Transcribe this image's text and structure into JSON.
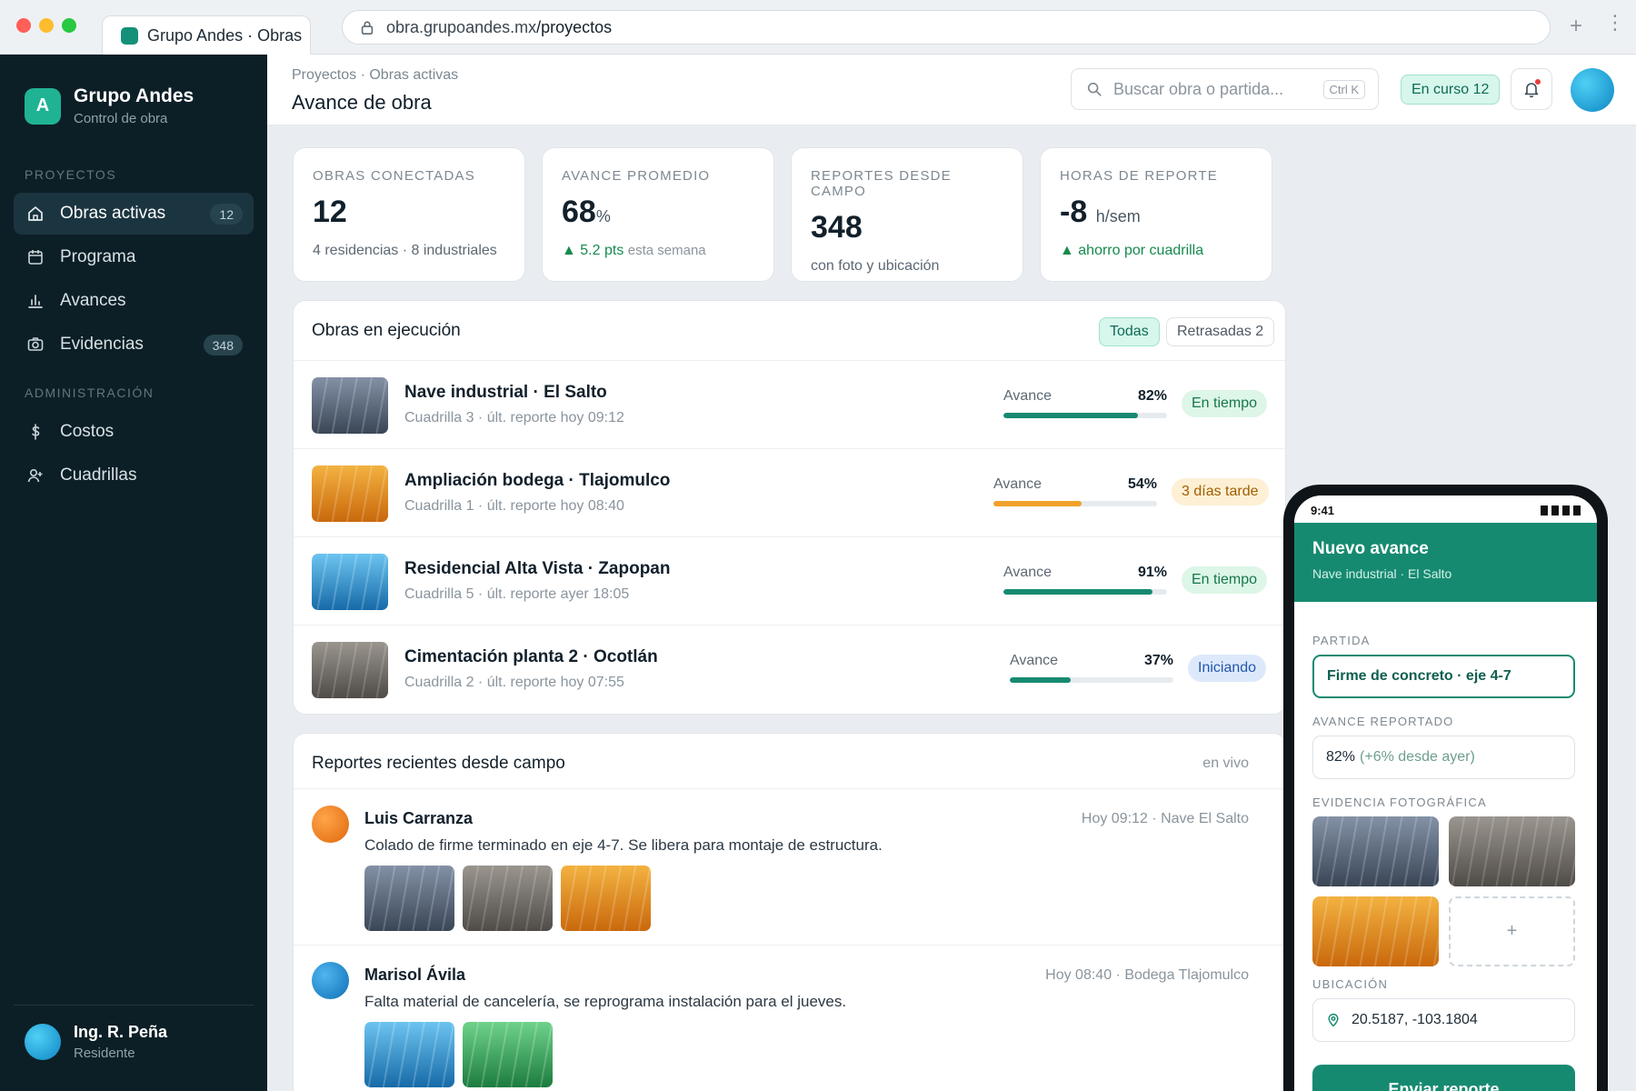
{
  "browser": {
    "tab_title": "Grupo Andes · Obras",
    "url_host": "obra.grupoandes.mx",
    "url_path": "/proyectos",
    "new_tab_label": "+",
    "menu_label": "⋮"
  },
  "sidebar": {
    "brand_letter": "A",
    "brand_name": "Grupo Andes",
    "brand_sub": "Control de obra",
    "section_projects": "PROYECTOS",
    "section_admin": "ADMINISTRACIÓN",
    "items": [
      {
        "label": "Obras activas",
        "badge": "12",
        "icon": "home-icon"
      },
      {
        "label": "Programa",
        "icon": "calendar-icon"
      },
      {
        "label": "Avances",
        "icon": "bar-chart-icon"
      },
      {
        "label": "Evidencias",
        "badge": "348",
        "icon": "camera-icon"
      },
      {
        "label": "Costos",
        "icon": "dollar-icon"
      },
      {
        "label": "Cuadrillas",
        "icon": "user-add-icon"
      }
    ],
    "user_name": "Ing. R. Peña",
    "user_role": "Residente"
  },
  "header": {
    "breadcrumb": "Proyectos · Obras activas",
    "title": "Avance de obra",
    "search_placeholder": "Buscar obra o partida...",
    "shortcut": "Ctrl K",
    "status_pill": "En curso 12"
  },
  "stats": [
    {
      "label": "OBRAS CONECTADAS",
      "value": "12",
      "unit": "",
      "note": "4 residencias · 8 industriales"
    },
    {
      "label": "AVANCE PROMEDIO",
      "value": "68",
      "unit": "%",
      "note_up": "▲ 5.2 pts",
      "note": "esta semana"
    },
    {
      "label": "REPORTES DESDE CAMPO",
      "value": "348",
      "unit": "",
      "note": "con foto y ubicación"
    },
    {
      "label": "HORAS DE REPORTE",
      "value": "-8",
      "unit": "h/sem",
      "note_up": "▲ ahorro por cuadrilla"
    }
  ],
  "projects": {
    "title": "Obras en ejecución",
    "filter_all": "Todas",
    "filter_late": "Retrasadas 2",
    "progress_label": "Avance",
    "rows": [
      {
        "name": "Nave industrial · El Salto",
        "sub": "Cuadrilla 3 · últ. reporte hoy 09:12",
        "progress": 82,
        "pct": "82%",
        "status": "En tiempo",
        "kind": "ok",
        "thumb": "t-slate",
        "color": "#168a71"
      },
      {
        "name": "Ampliación bodega · Tlajomulco",
        "sub": "Cuadrilla 1 · últ. reporte hoy 08:40",
        "progress": 54,
        "pct": "54%",
        "status": "3 días tarde",
        "kind": "late",
        "thumb": "t-orange",
        "color": "#f0a12b"
      },
      {
        "name": "Residencial Alta Vista · Zapopan",
        "sub": "Cuadrilla 5 · últ. reporte ayer 18:05",
        "progress": 91,
        "pct": "91%",
        "status": "En tiempo",
        "kind": "ok",
        "thumb": "t-blue",
        "color": "#168a71"
      },
      {
        "name": "Cimentación planta 2 · Ocotlán",
        "sub": "Cuadrilla 2 · últ. reporte hoy 07:55",
        "progress": 37,
        "pct": "37%",
        "status": "Iniciando",
        "kind": "start",
        "thumb": "t-gray",
        "color": "#168a71"
      }
    ]
  },
  "reports": {
    "title": "Reportes recientes desde campo",
    "live": "en vivo",
    "items": [
      {
        "author": "Luis Carranza",
        "meta": "Hoy 09:12 · Nave El Salto",
        "text": "Colado de firme terminado en eje 4-7. Se libera para montaje de estructura.",
        "avatar": "#f07d16"
      },
      {
        "author": "Marisol Ávila",
        "meta": "Hoy 08:40 · Bodega Tlajomulco",
        "text": "Falta material de cancelería, se reprograma instalación para el jueves.",
        "avatar": "#1a8fd6"
      }
    ]
  },
  "phone": {
    "time": "9:41",
    "title": "Nuevo avance",
    "subtitle": "Nave industrial · El Salto",
    "label_partida": "PARTIDA",
    "partida": "Firme de concreto · eje 4-7",
    "label_avance": "AVANCE REPORTADO",
    "avance": "82%",
    "avance_delta": "(+6% desde ayer)",
    "label_evidencia": "EVIDENCIA FOTOGRÁFICA",
    "add_photo": "+",
    "label_ubicacion": "UBICACIÓN",
    "coords": "20.5187, -103.1804",
    "submit": "Enviar reporte"
  },
  "colors": {
    "accent": "#168a71",
    "sidebar_bg": "#0d1f26",
    "late": "#f0a12b"
  }
}
